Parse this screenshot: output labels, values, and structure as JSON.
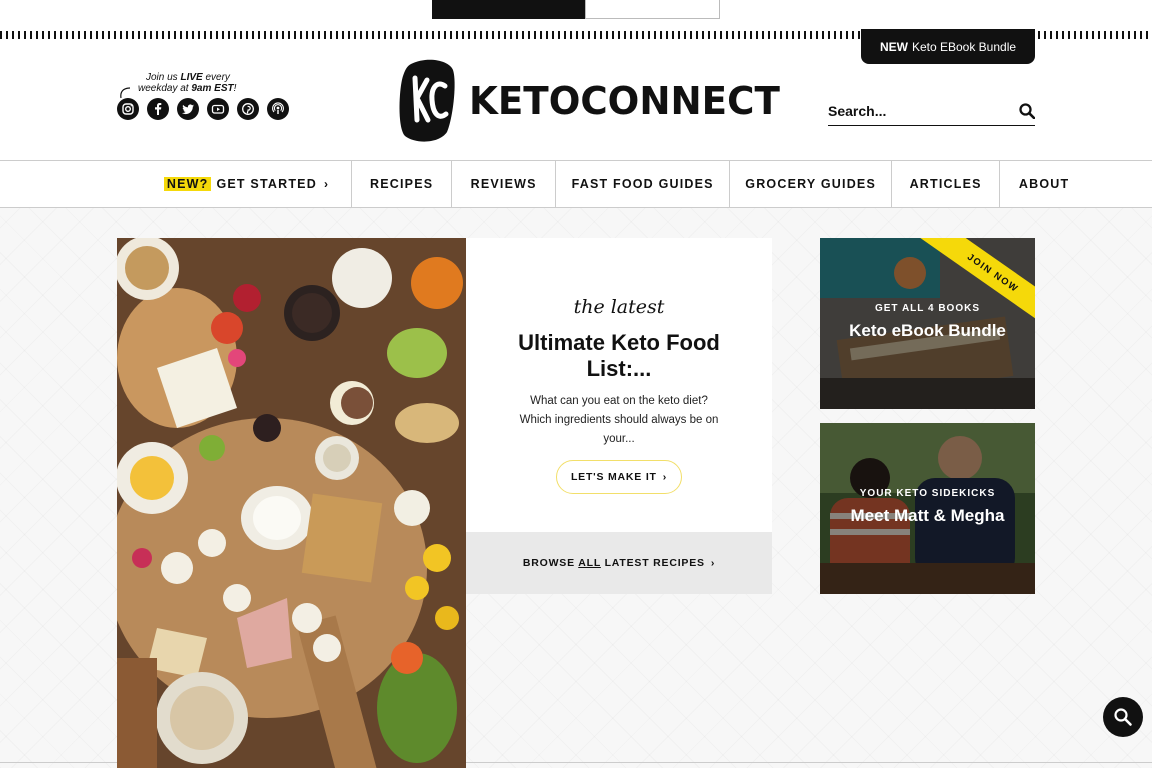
{
  "header": {
    "ebook_button": {
      "new_label": "NEW",
      "label": "Keto EBook Bundle"
    },
    "social": {
      "note_line1_pre": "Join us ",
      "note_line1_bold": "LIVE",
      "note_line1_post": " every",
      "note_line2_pre": "weekday at ",
      "note_line2_bold": "9am EST",
      "note_line2_post": "!",
      "icons": [
        "instagram-icon",
        "facebook-icon",
        "twitter-icon",
        "youtube-icon",
        "pinterest-icon",
        "podcast-icon"
      ]
    },
    "logo": {
      "mark": "KC",
      "text": "KETOCONNECT"
    },
    "search": {
      "placeholder": "Search..."
    }
  },
  "nav": {
    "items": [
      {
        "badge": "NEW?",
        "label": "GET STARTED",
        "chevron": "›"
      },
      {
        "label": "RECIPES"
      },
      {
        "label": "REVIEWS"
      },
      {
        "label": "FAST FOOD GUIDES"
      },
      {
        "label": "GROCERY GUIDES"
      },
      {
        "label": "ARTICLES"
      },
      {
        "label": "ABOUT"
      }
    ]
  },
  "latest": {
    "kicker": "the latest",
    "title": "Ultimate Keto Food List:...",
    "excerpt": "What can you eat on the keto diet? Which ingredients should always be on your...",
    "button": "LET'S MAKE IT",
    "button_chevron": "›"
  },
  "browse": {
    "pre": "BROWSE ",
    "underlined": "ALL",
    "post": " LATEST RECIPES",
    "chevron": "›"
  },
  "side_cards": [
    {
      "ribbon": "JOIN NOW",
      "kicker": "GET ALL 4 BOOKS",
      "title": "Keto eBook Bundle"
    },
    {
      "kicker": "YOUR KETO SIDEKICKS",
      "title": "Meet Matt & Megha"
    }
  ],
  "colors": {
    "accent_yellow": "#f5d90a",
    "dark": "#111111"
  }
}
